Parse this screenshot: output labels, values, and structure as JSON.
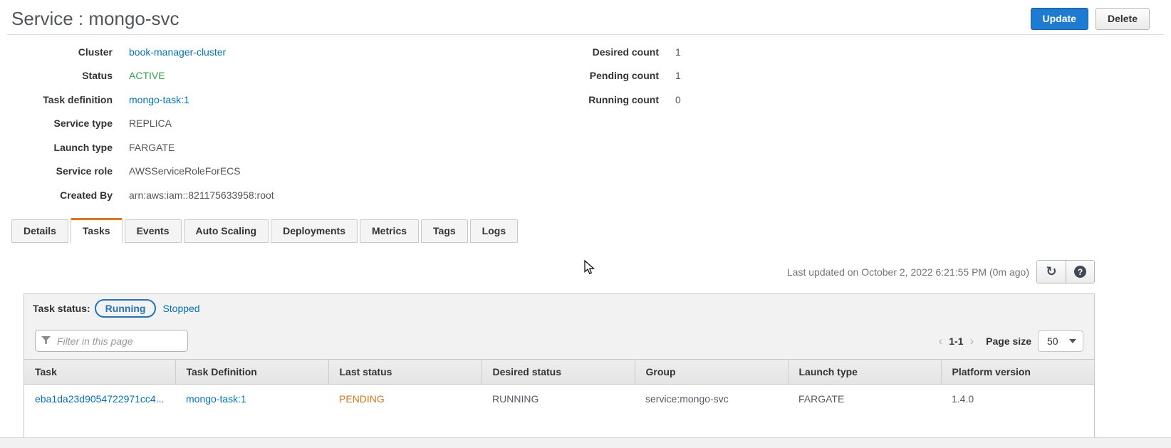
{
  "header": {
    "title": "Service : mongo-svc",
    "update_button": "Update",
    "delete_button": "Delete"
  },
  "details": {
    "left": [
      {
        "label": "Cluster",
        "value": "book-manager-cluster"
      },
      {
        "label": "Status",
        "value": "ACTIVE"
      },
      {
        "label": "Task definition",
        "value": "mongo-task:1"
      },
      {
        "label": "Service type",
        "value": "REPLICA"
      },
      {
        "label": "Launch type",
        "value": "FARGATE"
      },
      {
        "label": "Service role",
        "value": "AWSServiceRoleForECS"
      },
      {
        "label": "Created By",
        "value": "arn:aws:iam::821175633958:root"
      }
    ],
    "right": [
      {
        "label": "Desired count",
        "value": "1"
      },
      {
        "label": "Pending count",
        "value": "1"
      },
      {
        "label": "Running count",
        "value": "0"
      }
    ]
  },
  "tabs": [
    "Details",
    "Tasks",
    "Events",
    "Auto Scaling",
    "Deployments",
    "Metrics",
    "Tags",
    "Logs"
  ],
  "active_tab": "Tasks",
  "tasks_panel": {
    "last_updated": "Last updated on October 2, 2022 6:21:55 PM (0m ago)",
    "task_status_label": "Task status:",
    "running_filter": "Running",
    "stopped_filter": "Stopped",
    "filter_placeholder": "Filter in this page",
    "pagination": {
      "prev": "‹",
      "range": "1-1",
      "next": "›",
      "page_size_label": "Page size",
      "page_size_value": "50"
    }
  },
  "table": {
    "columns": [
      "Task",
      "Task Definition",
      "Last status",
      "Desired status",
      "Group",
      "Launch type",
      "Platform version"
    ],
    "rows": [
      [
        "eba1da23d9054722971cc4...",
        "mongo-task:1",
        "PENDING",
        "RUNNING",
        "service:mongo-svc",
        "FARGATE",
        "1.4.0"
      ]
    ]
  },
  "colors": {
    "link_blue": "#0073bb",
    "status_active_green": "#2ba84a",
    "pending_orange": "#d2791c",
    "active_tab_orange": "#ec7211",
    "primary_button_blue": "#1e7bd4"
  }
}
